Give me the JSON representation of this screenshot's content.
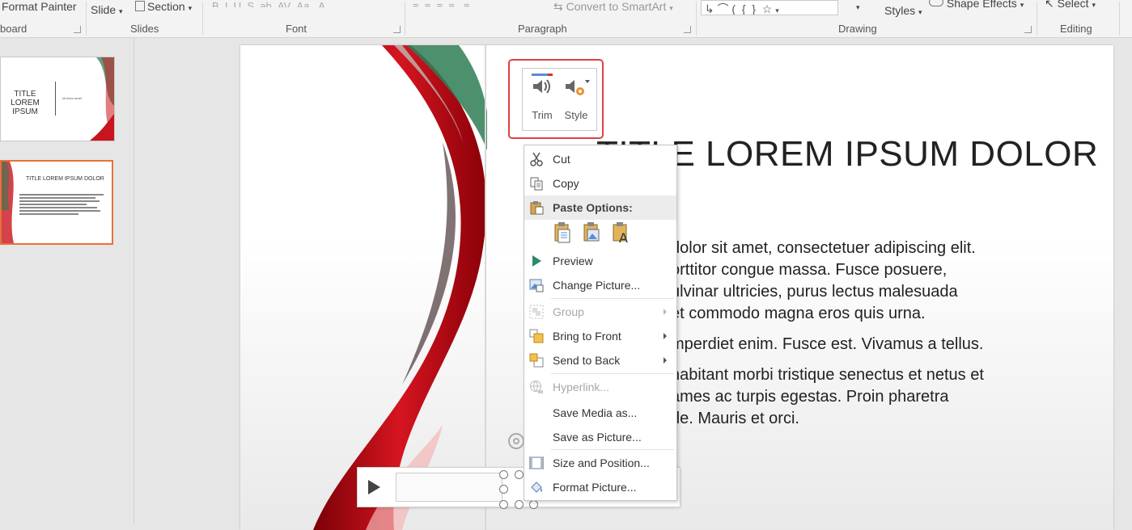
{
  "ribbon": {
    "format_painter": "Format Painter",
    "slide_btn": "Slide",
    "section_btn": "Section",
    "convert_smartart": "Convert to SmartArt",
    "styles_btn": "Styles",
    "shape_effects": "Shape Effects",
    "select_btn": "Select",
    "groups": {
      "clipboard": "board",
      "slides": "Slides",
      "font": "Font",
      "paragraph": "Paragraph",
      "drawing": "Drawing",
      "editing": "Editing"
    }
  },
  "thumbnails": [
    {
      "title": "TITLE LOREM IPSUM",
      "subtitle": "sit dolor amet"
    },
    {
      "title": "TITLE LOREM IPSUM DOLOR"
    }
  ],
  "slide": {
    "title": "TITLE LOREM IPSUM DOLOR",
    "body_lines": [
      "dolor sit amet, consectetuer adipiscing elit.",
      "orttitor congue massa. Fusce posuere,",
      "ulvinar ultricies, purus lectus malesuada",
      "et commodo magna eros quis urna.",
      "mperdiet enim. Fusce est. Vivamus a tellus.",
      "habitant morbi tristique senectus et netus et",
      "ames ac turpis egestas. Proin pharetra",
      "de. Mauris et orci."
    ]
  },
  "mini_toolbar": {
    "trim": "Trim",
    "style": "Style"
  },
  "context_menu": {
    "cut": "Cut",
    "copy": "Copy",
    "paste_options": "Paste Options:",
    "preview": "Preview",
    "change_picture": "Change Picture...",
    "group": "Group",
    "bring_to_front": "Bring to Front",
    "send_to_back": "Send to Back",
    "hyperlink": "Hyperlink...",
    "save_media_as": "Save Media as...",
    "save_as_picture": "Save as Picture...",
    "size_and_position": "Size and Position...",
    "format_picture": "Format Picture..."
  },
  "colors": {
    "highlight_red": "#e04040",
    "thumb_selected": "#e8703a",
    "accent_red": "#c8141c",
    "accent_green": "#2e7d55"
  }
}
